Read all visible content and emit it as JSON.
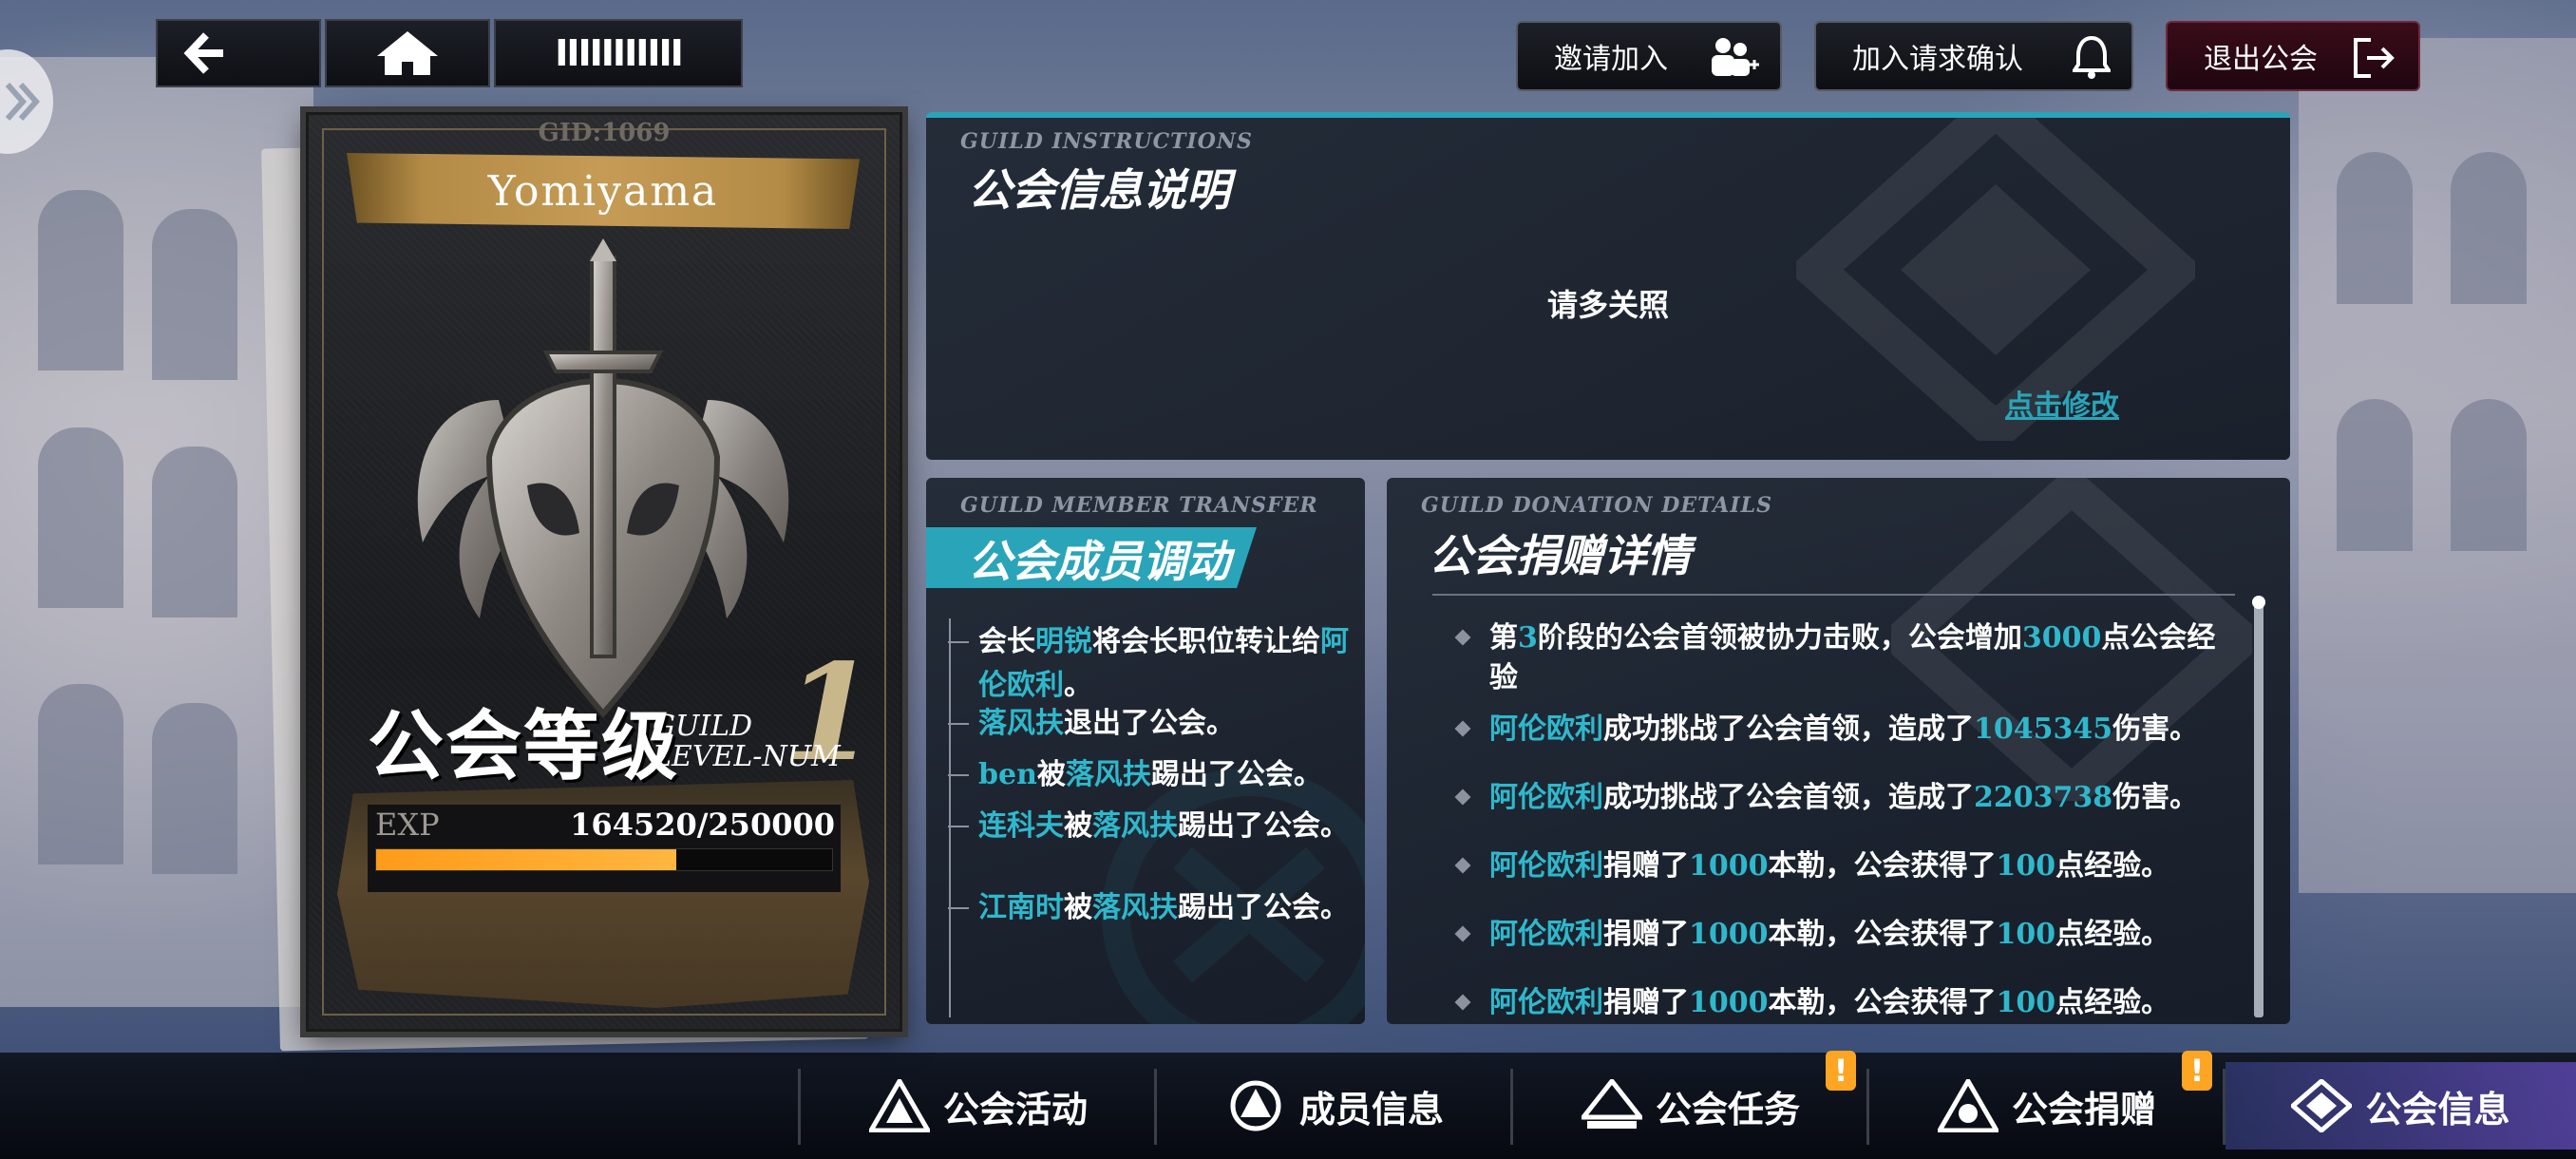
{
  "top_nav": {
    "back_icon": "back-arrow-icon",
    "home_icon": "home-icon",
    "menu_label": "IIIIIIIIIII"
  },
  "actions": {
    "invite_label": "邀请加入",
    "request_label": "加入请求确认",
    "exit_label": "退出公会"
  },
  "guild_card": {
    "gid": "GID:1069",
    "name": "Yomiyama",
    "level_label_zh": "公会等级",
    "level_label_en_1": "GUILD",
    "level_label_en_2": "LEVEL-NUM",
    "level": "1",
    "exp_label": "EXP",
    "exp_text": "164520/250000",
    "exp_fraction": 0.658
  },
  "instructions": {
    "en_title": "GUILD INSTRUCTIONS",
    "zh_title": "公会信息说明",
    "motto": "请多关照",
    "edit_link": "点击修改"
  },
  "transfer": {
    "en_title": "GUILD MEMBER TRANSFER",
    "zh_title": "公会成员调动",
    "items": [
      {
        "parts": [
          [
            "会长",
            false
          ],
          [
            "明锐",
            true
          ],
          [
            "将会长职位转让给",
            false
          ],
          [
            "阿伦欧利",
            true
          ],
          [
            "。",
            false
          ]
        ]
      },
      {
        "parts": [
          [
            "落风扶",
            true
          ],
          [
            "退出了公会。",
            false
          ]
        ]
      },
      {
        "parts": [
          [
            "ben",
            true
          ],
          [
            "被",
            false
          ],
          [
            "落风扶",
            true
          ],
          [
            "踢出了公会。",
            false
          ]
        ]
      },
      {
        "parts": [
          [
            "连科夫",
            true
          ],
          [
            "被",
            false
          ],
          [
            "落风扶",
            true
          ],
          [
            "踢出了公会。",
            false
          ]
        ]
      },
      {
        "parts": [
          [
            "江南时",
            true
          ],
          [
            "被",
            false
          ],
          [
            "落风扶",
            true
          ],
          [
            "踢出了公会。",
            false
          ]
        ]
      }
    ]
  },
  "donation": {
    "en_title": "GUILD DONATION DETAILS",
    "zh_title": "公会捐赠详情",
    "items": [
      {
        "parts": [
          [
            "第",
            false
          ],
          [
            "3",
            true
          ],
          [
            "阶段的公会首领被协力击败，公会增加",
            false
          ],
          [
            "3000",
            true
          ],
          [
            "点公会经验",
            false
          ]
        ]
      },
      {
        "parts": [
          [
            "阿伦欧利",
            true
          ],
          [
            "成功挑战了公会首领，造成了",
            false
          ],
          [
            "1045345",
            true
          ],
          [
            "伤害。",
            false
          ]
        ]
      },
      {
        "parts": [
          [
            "阿伦欧利",
            true
          ],
          [
            "成功挑战了公会首领，造成了",
            false
          ],
          [
            "2203738",
            true
          ],
          [
            "伤害。",
            false
          ]
        ]
      },
      {
        "parts": [
          [
            "阿伦欧利",
            true
          ],
          [
            "捐赠了",
            false
          ],
          [
            "1000",
            true
          ],
          [
            "本勒，公会获得了",
            false
          ],
          [
            "100",
            true
          ],
          [
            "点经验。",
            false
          ]
        ]
      },
      {
        "parts": [
          [
            "阿伦欧利",
            true
          ],
          [
            "捐赠了",
            false
          ],
          [
            "1000",
            true
          ],
          [
            "本勒，公会获得了",
            false
          ],
          [
            "100",
            true
          ],
          [
            "点经验。",
            false
          ]
        ]
      },
      {
        "parts": [
          [
            "阿伦欧利",
            true
          ],
          [
            "捐赠了",
            false
          ],
          [
            "1000",
            true
          ],
          [
            "本勒，公会获得了",
            false
          ],
          [
            "100",
            true
          ],
          [
            "点经验。",
            false
          ]
        ]
      }
    ]
  },
  "tabs": [
    {
      "label": "公会活动",
      "icon": "guild-activity-icon",
      "badge": ""
    },
    {
      "label": "成员信息",
      "icon": "member-info-icon",
      "badge": ""
    },
    {
      "label": "公会任务",
      "icon": "guild-task-icon",
      "badge": "!"
    },
    {
      "label": "公会捐赠",
      "icon": "guild-donation-icon",
      "badge": "!"
    },
    {
      "label": "公会信息",
      "icon": "guild-info-icon",
      "badge": ""
    }
  ],
  "colors": {
    "accent": "#2aa4b8",
    "highlight_text": "#2fb8cc",
    "exp_bar": "#ff9b1a",
    "badge": "#ffa524",
    "exit_button": "#3a0c19"
  }
}
